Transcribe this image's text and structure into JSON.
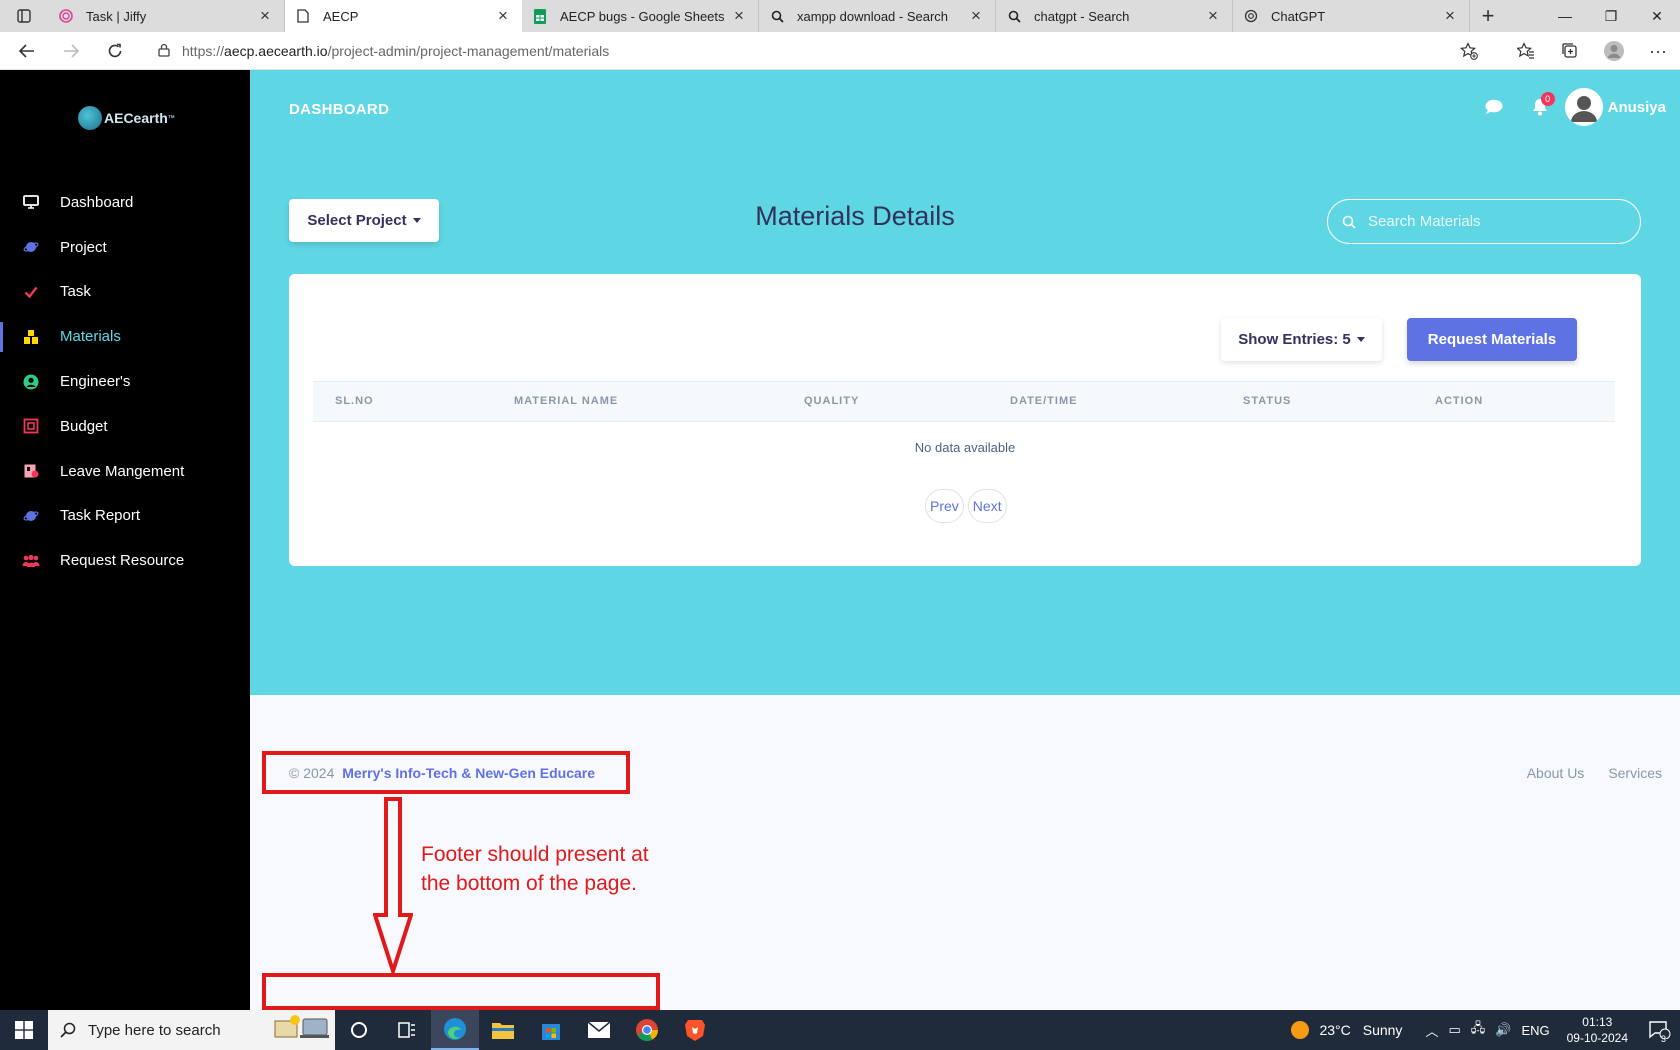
{
  "browser": {
    "tabs": [
      {
        "title": "Task | Jiffy",
        "icon": "fingerprint-icon",
        "active": false
      },
      {
        "title": "AECP",
        "icon": "page-icon",
        "active": true
      },
      {
        "title": "AECP bugs - Google Sheets",
        "icon": "sheets-icon",
        "active": false
      },
      {
        "title": "xampp download - Search",
        "icon": "search-icon",
        "active": false
      },
      {
        "title": "chatgpt - Search",
        "icon": "search-icon",
        "active": false
      },
      {
        "title": "ChatGPT",
        "icon": "openai-icon",
        "active": false
      }
    ],
    "url_prefix": "https://",
    "url_host": "aecp.aecearth.io",
    "url_path": "/project-admin/project-management/materials"
  },
  "sidebar": {
    "logo_text": "AECearth",
    "logo_tm": "™",
    "items": [
      {
        "label": "Dashboard",
        "icon": "monitor-icon",
        "color": "#ffffff"
      },
      {
        "label": "Project",
        "icon": "planet-icon",
        "color": "#5e72e4"
      },
      {
        "label": "Task",
        "icon": "check-icon",
        "color": "#f5365c"
      },
      {
        "label": "Materials",
        "icon": "boxes-icon",
        "color": "#ffd600",
        "active": true
      },
      {
        "label": "Engineer's",
        "icon": "user-circle-icon",
        "color": "#2dce89"
      },
      {
        "label": "Budget",
        "icon": "budget-icon",
        "color": "#f5365c"
      },
      {
        "label": "Leave Mangement",
        "icon": "calendar-icon",
        "color": "#f3a4b5"
      },
      {
        "label": "Task Report",
        "icon": "planet-icon",
        "color": "#5e72e4"
      },
      {
        "label": "Request Resource",
        "icon": "people-icon",
        "color": "#f5365c"
      }
    ]
  },
  "header": {
    "title": "DASHBOARD",
    "notification_count": "0",
    "user_name": "Anusiya"
  },
  "main": {
    "select_project_label": "Select Project",
    "page_title": "Materials Details",
    "search_placeholder": "Search Materials",
    "show_entries_label": "Show Entries: 5",
    "request_button_label": "Request Materials",
    "table": {
      "columns": [
        "SL.NO",
        "MATERIAL NAME",
        "QUALITY",
        "DATE/TIME",
        "STATUS",
        "ACTION"
      ],
      "empty_text": "No data available"
    },
    "pagination": {
      "prev": "Prev",
      "next": "Next"
    }
  },
  "footer": {
    "copyright": "© 2024",
    "company": "Merry's Info-Tech & New-Gen Educare",
    "links": [
      "About Us",
      "Services"
    ]
  },
  "annotation": {
    "text": "Footer should present at the bottom of the page.",
    "color": "#e01a1a"
  },
  "taskbar": {
    "search_placeholder": "Type here to search",
    "weather_temp": "23°C",
    "weather_desc": "Sunny",
    "language": "ENG",
    "time": "01:13",
    "date": "09-10-2024",
    "notification_count": "3"
  },
  "colors": {
    "hero": "#5fd6e3",
    "primary": "#5e72e4",
    "sidebar": "#000000",
    "heading": "#32325d"
  }
}
